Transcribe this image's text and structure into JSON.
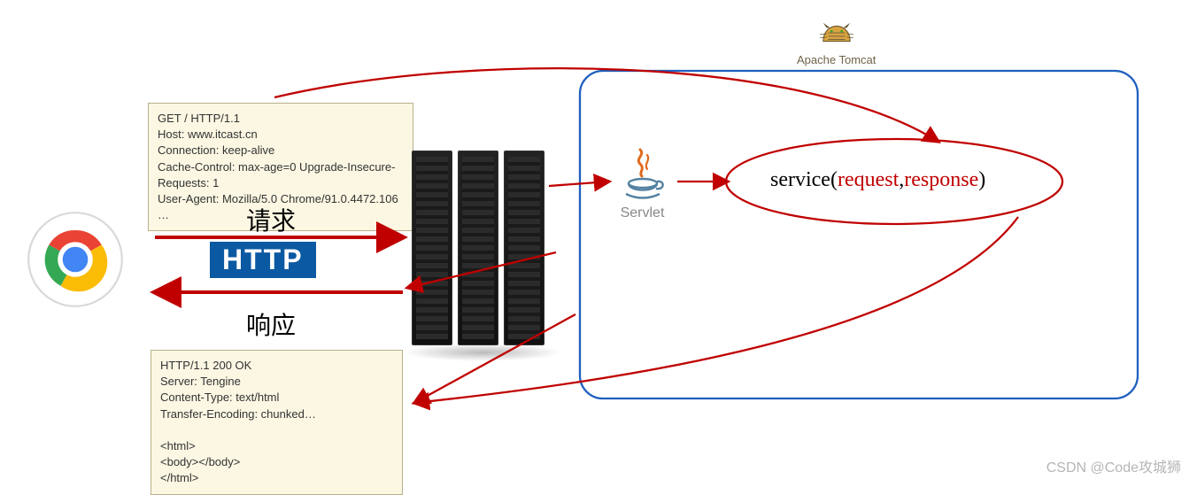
{
  "tomcat": {
    "label": "Apache Tomcat"
  },
  "servlet": {
    "label": "Servlet"
  },
  "labels": {
    "request": "请求",
    "response": "响应",
    "http": "HTTP"
  },
  "service_call": {
    "prefix": "service(",
    "arg1": "request",
    "comma": ",",
    "arg2": "response",
    "suffix": ")"
  },
  "request_box": {
    "text": "GET / HTTP/1.1\nHost: www.itcast.cn\nConnection: keep-alive\nCache-Control: max-age=0 Upgrade-Insecure-Requests: 1\nUser-Agent: Mozilla/5.0 Chrome/91.0.4472.106\n…"
  },
  "response_box": {
    "text": "HTTP/1.1 200 OK\nServer: Tengine\nContent-Type: text/html\nTransfer-Encoding: chunked…\n\n<html>\n<body></body>\n</html>"
  },
  "watermark": "CSDN @Code攻城狮"
}
